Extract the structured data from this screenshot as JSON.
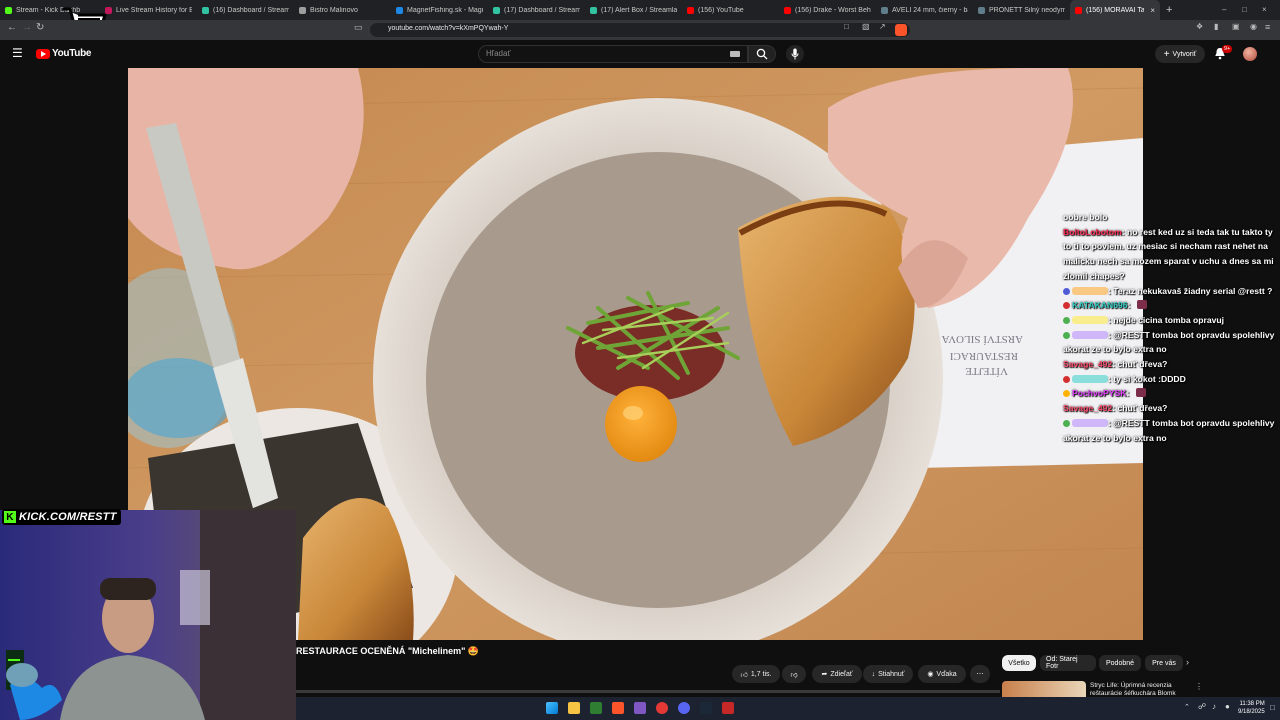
{
  "browser": {
    "tabs": [
      {
        "title": "Stream - Kick Dashb",
        "fav": "#53fc18"
      },
      {
        "title": "Live Stream History for Ble",
        "fav": "#c2185b"
      },
      {
        "title": "(16) Dashboard / Streamlab",
        "fav": "#31c3a2"
      },
      {
        "title": "Bistro Malinovo",
        "fav": "#9e9e9e"
      },
      {
        "title": "MagnetFishing.sk - Magne",
        "fav": "#1e88e5"
      },
      {
        "title": "(17) Dashboard / Streamlab",
        "fav": "#31c3a2"
      },
      {
        "title": "(17) Alert Box / Streamlabs",
        "fav": "#31c3a2"
      },
      {
        "title": "(156) YouTube",
        "fav": "#ff0000"
      },
      {
        "title": "(156) Drake - Worst Behav",
        "fav": "#ff0000"
      },
      {
        "title": "AVELI 24 mm, čierny - balen",
        "fav": "#607d8b"
      },
      {
        "title": "PRONETT Silný neodymov",
        "fav": "#607d8b"
      },
      {
        "title": "(156) MORAVAI Tal",
        "fav": "#ff0000",
        "active": true
      }
    ],
    "new_tab": "+",
    "url": "youtube.com/watch?v=kXmPQYwah-Y"
  },
  "youtube": {
    "logo_text": "YouTube",
    "search_placeholder": "Hľadať",
    "create_label": "Vytvoriť",
    "notification_badge": "9+",
    "video_title": "RESTAURACE OCENĚNÁ \"Michelinem\" 🤩",
    "actions": {
      "likes": "1,7 tis.",
      "share": "Zdieľať",
      "download": "Stiahnuť",
      "thanks": "Vďaka",
      "more": "⋯"
    },
    "chips": [
      "Všetko",
      "Od: Starej Fotr",
      "Podobné",
      "Pre vás"
    ],
    "recommended": {
      "title": "Stryc Life: Úprimná recenzia reštaurácie šéfkuchára Blomk"
    }
  },
  "overlay": {
    "kick_label": "KICK.COM/RESTT",
    "chat": [
      {
        "user": "",
        "text": "oobre bolo",
        "color": "#ffffff",
        "wrap": false,
        "clip": true
      },
      {
        "user": "BoltoLobotom",
        "text": "no rest ked uz si teda tak tu takto ty to ti to poviem. uz mesiac si necham rast nehet na malicku nech sa mozem sparat v uchu a dnes sa mi zlomil chapes?",
        "color": "#ff2a55",
        "wrap": true
      },
      {
        "user": "",
        "text": "Teraz nekukavaš žiadny serial @restt ?",
        "color": "#ffa726",
        "wrap": true,
        "badge": "#4f5bd5"
      },
      {
        "user": "KATAKAN696",
        "text": "",
        "color": "#35d0c7",
        "badge": "#d32f2f"
      },
      {
        "user": "",
        "text": "nejde cicina tomba opravuj",
        "color": "#ffeb3b",
        "badge": "#4caf50"
      },
      {
        "user": "",
        "text": "@RESTT tomba bot opravdu spolehlivy akorat ze to bylo extra no",
        "color": "#b388ff",
        "wrap": true,
        "badge": "#4caf50"
      },
      {
        "user": "Savage_492",
        "text": "chuť dřeva?",
        "color": "#ff4d6d"
      },
      {
        "user": "",
        "text": "ty si kokot :DDDD",
        "color": "#35d0c7",
        "badge": "#d32f2f"
      },
      {
        "user": "PochvoPYSK",
        "text": "",
        "color": "#e040fb",
        "badge": "#ffb300"
      },
      {
        "user": "Savage_492",
        "text": "chuť dřeva?",
        "color": "#ff4d6d"
      },
      {
        "user": "",
        "text": "@RESTT tomba bot opravdu spolehlivy akorat ze to bylo extra no",
        "color": "#b388ff",
        "wrap": true,
        "badge": "#4caf50"
      }
    ]
  },
  "taskbar": {
    "time": "11:38 PM",
    "date": "9/18/2025"
  }
}
